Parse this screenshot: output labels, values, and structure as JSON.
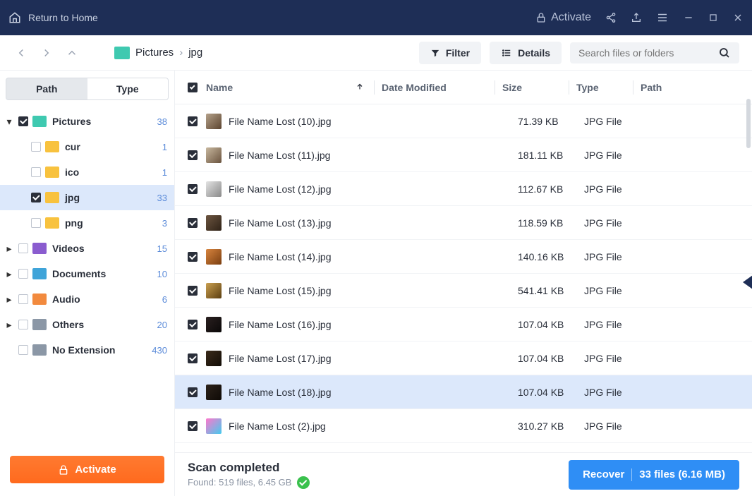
{
  "titlebar": {
    "home_label": "Return to Home",
    "activate_label": "Activate"
  },
  "toolbar": {
    "breadcrumb": [
      "Pictures",
      "jpg"
    ],
    "filter_label": "Filter",
    "details_label": "Details",
    "search_placeholder": "Search files or folders"
  },
  "sidebar": {
    "tabs": {
      "path": "Path",
      "type": "Type"
    },
    "tree": [
      {
        "label": "Pictures",
        "count": 38,
        "icon": "teal",
        "checked": true,
        "depth": 0,
        "expanded": true
      },
      {
        "label": "cur",
        "count": 1,
        "icon": "yellow",
        "checked": false,
        "depth": 1
      },
      {
        "label": "ico",
        "count": 1,
        "icon": "yellow",
        "checked": false,
        "depth": 1
      },
      {
        "label": "jpg",
        "count": 33,
        "icon": "yellow",
        "checked": true,
        "depth": 1,
        "selected": true
      },
      {
        "label": "png",
        "count": 3,
        "icon": "yellow",
        "checked": false,
        "depth": 1
      },
      {
        "label": "Videos",
        "count": 15,
        "icon": "purple",
        "checked": false,
        "depth": 0,
        "collapsed": true
      },
      {
        "label": "Documents",
        "count": 10,
        "icon": "blue",
        "checked": false,
        "depth": 0,
        "collapsed": true
      },
      {
        "label": "Audio",
        "count": 6,
        "icon": "orange",
        "checked": false,
        "depth": 0,
        "collapsed": true
      },
      {
        "label": "Others",
        "count": 20,
        "icon": "gray",
        "checked": false,
        "depth": 0,
        "collapsed": true
      },
      {
        "label": "No Extension",
        "count": 430,
        "icon": "gray",
        "checked": false,
        "depth": 0
      }
    ],
    "activate_label": "Activate"
  },
  "table": {
    "headers": {
      "name": "Name",
      "date": "Date Modified",
      "size": "Size",
      "type": "Type",
      "path": "Path"
    },
    "rows": [
      {
        "name": "File Name Lost (10).jpg",
        "size": "71.39 KB",
        "type": "JPG File",
        "checked": true
      },
      {
        "name": "File Name Lost (11).jpg",
        "size": "181.11 KB",
        "type": "JPG File",
        "checked": true
      },
      {
        "name": "File Name Lost (12).jpg",
        "size": "112.67 KB",
        "type": "JPG File",
        "checked": true
      },
      {
        "name": "File Name Lost (13).jpg",
        "size": "118.59 KB",
        "type": "JPG File",
        "checked": true
      },
      {
        "name": "File Name Lost (14).jpg",
        "size": "140.16 KB",
        "type": "JPG File",
        "checked": true
      },
      {
        "name": "File Name Lost (15).jpg",
        "size": "541.41 KB",
        "type": "JPG File",
        "checked": true
      },
      {
        "name": "File Name Lost (16).jpg",
        "size": "107.04 KB",
        "type": "JPG File",
        "checked": true
      },
      {
        "name": "File Name Lost (17).jpg",
        "size": "107.04 KB",
        "type": "JPG File",
        "checked": true
      },
      {
        "name": "File Name Lost (18).jpg",
        "size": "107.04 KB",
        "type": "JPG File",
        "checked": true,
        "selected": true
      },
      {
        "name": "File Name Lost (2).jpg",
        "size": "310.27 KB",
        "type": "JPG File",
        "checked": true
      }
    ]
  },
  "status": {
    "title": "Scan completed",
    "subtitle": "Found: 519 files, 6.45 GB",
    "recover_label": "Recover",
    "recover_count": "33 files (6.16 MB)"
  },
  "thumbs": [
    "linear-gradient(135deg,#b5a18a,#5b442f)",
    "linear-gradient(135deg,#c8b89f,#6a533e)",
    "linear-gradient(135deg,#e3e3e3,#8a8a8a)",
    "linear-gradient(135deg,#6c5540,#2f2217)",
    "linear-gradient(135deg,#d8843e,#7a3e10)",
    "linear-gradient(135deg,#caa050,#5b3e10)",
    "linear-gradient(135deg,#2a2020,#0a0808)",
    "linear-gradient(135deg,#3a2a1a,#120c06)",
    "linear-gradient(135deg,#2c221a,#0e0a06)",
    "linear-gradient(135deg,#ff77cc,#44ccee)"
  ]
}
